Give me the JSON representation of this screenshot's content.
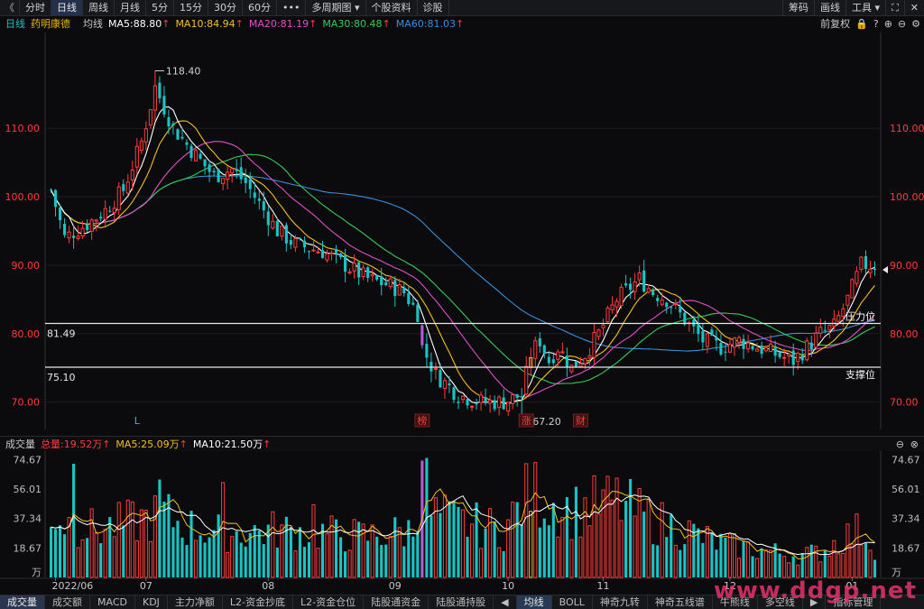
{
  "toolbar": {
    "back": "《",
    "tabs": [
      "分时",
      "日线",
      "周线",
      "月线",
      "5分",
      "15分",
      "30分",
      "60分",
      "•••",
      "多周期图 ▾",
      "个股资料",
      "诊股"
    ],
    "active_index": 1,
    "right": [
      "筹码",
      "画线",
      "工具 ▾",
      "⛶",
      "✕"
    ]
  },
  "info": {
    "period": "日线",
    "stock_name": "药明康德",
    "avg_label": "均线",
    "ma5": "MA5:88.80",
    "ma10": "MA10:84.94",
    "ma20": "MA20:81.19",
    "ma30": "MA30:80.48",
    "ma60": "MA60:81.03",
    "arrow": "↑",
    "adjust": "前复权"
  },
  "volume_info": {
    "label": "成交量",
    "total": "总量:19.52万",
    "ma5": "MA5:25.09万",
    "ma10": "MA10:21.50万",
    "arrow": "↑"
  },
  "bottom_tabs": [
    "成交量",
    "成交额",
    "MACD",
    "KDJ",
    "主力净额",
    "L2-资金抄底",
    "L2-资金仓位",
    "陆股通资金",
    "陆股通持股",
    "◀",
    "均线",
    "BOLL",
    "神奇九转",
    "神奇五线谱",
    "牛熊线",
    "多空线",
    "▶",
    "指标管理"
  ],
  "watermark": "www.ddgp.net",
  "colors": {
    "up": "#ff3b3b",
    "down": "#18c4c4",
    "ma5": "#ffffff",
    "ma10": "#f0c020",
    "ma20": "#e04fc8",
    "ma30": "#33cc55",
    "ma60": "#3a8fd8"
  },
  "chart_data": {
    "type": "candlestick",
    "price_axis": {
      "ticks": [
        70.0,
        80.0,
        90.0,
        100.0,
        110.0
      ],
      "ylim": [
        66,
        124
      ]
    },
    "volume_axis": {
      "ticks": [
        "74.67",
        "56.01",
        "37.34",
        "18.67"
      ],
      "unit": "万",
      "ylim": [
        0,
        80
      ]
    },
    "x_labels": [
      {
        "i": 1,
        "label": "2022/06"
      },
      {
        "i": 21,
        "label": "07"
      },
      {
        "i": 48,
        "label": "08"
      },
      {
        "i": 76,
        "label": "09"
      },
      {
        "i": 101,
        "label": "10"
      },
      {
        "i": 122,
        "label": "11"
      },
      {
        "i": 150,
        "label": "12"
      },
      {
        "i": 177,
        "label": "01"
      }
    ],
    "annotations": {
      "high": {
        "i": 23,
        "value": 118.4,
        "label": "118.40"
      },
      "low": {
        "i": 104,
        "value": 67.2,
        "label": "67.20"
      },
      "resistance": {
        "value": 81.49,
        "label": "81.49",
        "name": "压力位"
      },
      "support": {
        "value": 75.1,
        "label": "75.10",
        "name": "支撑位"
      }
    },
    "markers": [
      {
        "i": 19,
        "text": "L",
        "color": "#18c4c4"
      },
      {
        "i": 82,
        "text": "榜",
        "color": "#ff3b3b"
      },
      {
        "i": 105,
        "text": "涨",
        "color": "#ff3b3b"
      },
      {
        "i": 117,
        "text": "财",
        "color": "#ff3b3b"
      }
    ],
    "purple_bar_index": 82,
    "yellow_bar_index": 106,
    "ma_values": {
      "ma5": 88.8,
      "ma10": 84.94,
      "ma20": 81.19,
      "ma30": 80.48,
      "ma60": 81.03
    },
    "waypoints": [
      [
        0,
        101
      ],
      [
        3,
        94
      ],
      [
        8,
        96
      ],
      [
        12,
        98
      ],
      [
        16,
        101
      ],
      [
        20,
        108
      ],
      [
        23,
        116
      ],
      [
        27,
        110
      ],
      [
        32,
        106
      ],
      [
        36,
        103
      ],
      [
        40,
        104
      ],
      [
        43,
        102
      ],
      [
        46,
        99
      ],
      [
        50,
        95
      ],
      [
        54,
        93
      ],
      [
        60,
        92
      ],
      [
        65,
        90
      ],
      [
        70,
        88
      ],
      [
        75,
        87
      ],
      [
        78,
        86
      ],
      [
        81,
        83
      ],
      [
        82,
        78
      ],
      [
        85,
        74
      ],
      [
        90,
        71
      ],
      [
        95,
        70
      ],
      [
        100,
        70
      ],
      [
        104,
        71
      ],
      [
        106,
        77
      ],
      [
        108,
        79
      ],
      [
        110,
        76
      ],
      [
        112,
        78
      ],
      [
        115,
        75
      ],
      [
        118,
        77
      ],
      [
        121,
        80
      ],
      [
        125,
        85
      ],
      [
        130,
        88
      ],
      [
        133,
        86
      ],
      [
        136,
        85
      ],
      [
        140,
        82
      ],
      [
        144,
        79
      ],
      [
        148,
        78
      ],
      [
        152,
        79
      ],
      [
        156,
        78
      ],
      [
        160,
        77
      ],
      [
        164,
        76
      ],
      [
        167,
        78
      ],
      [
        170,
        80
      ],
      [
        173,
        81
      ],
      [
        176,
        85
      ],
      [
        179,
        90
      ],
      [
        182,
        90
      ]
    ],
    "volume_levels": [
      [
        0,
        42
      ],
      [
        3,
        35
      ],
      [
        10,
        30
      ],
      [
        20,
        36
      ],
      [
        25,
        40
      ],
      [
        30,
        32
      ],
      [
        40,
        28
      ],
      [
        50,
        30
      ],
      [
        60,
        28
      ],
      [
        70,
        26
      ],
      [
        80,
        30
      ],
      [
        82,
        74
      ],
      [
        84,
        40
      ],
      [
        90,
        35
      ],
      [
        100,
        30
      ],
      [
        106,
        55
      ],
      [
        110,
        48
      ],
      [
        115,
        42
      ],
      [
        120,
        45
      ],
      [
        125,
        48
      ],
      [
        130,
        40
      ],
      [
        135,
        34
      ],
      [
        140,
        30
      ],
      [
        145,
        24
      ],
      [
        150,
        20
      ],
      [
        155,
        18
      ],
      [
        160,
        16
      ],
      [
        165,
        14
      ],
      [
        170,
        16
      ],
      [
        175,
        25
      ],
      [
        179,
        30
      ],
      [
        182,
        20
      ]
    ]
  }
}
